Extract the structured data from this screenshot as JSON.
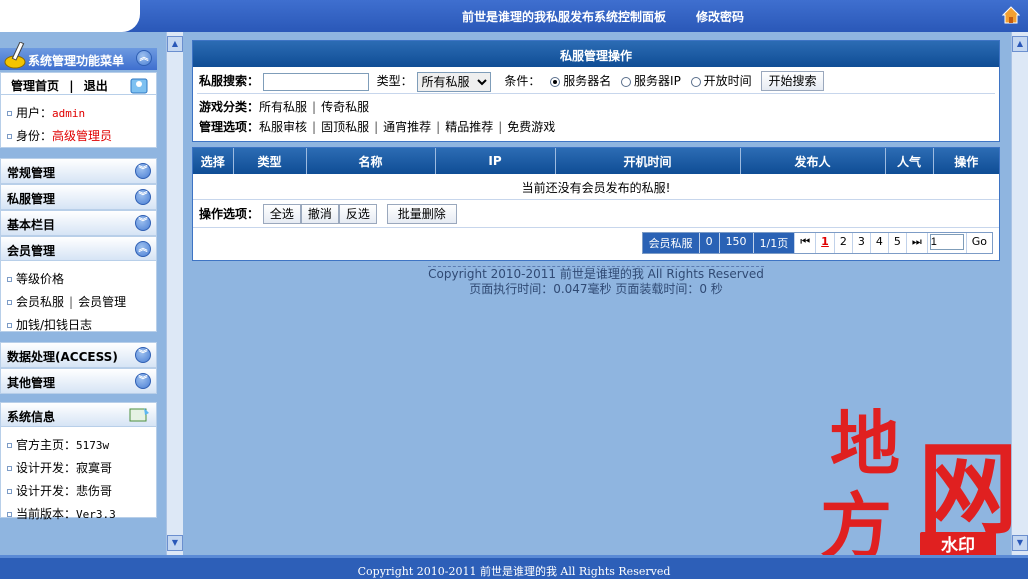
{
  "header": {
    "title": "前世是谁理的我私服发布系统控制面板",
    "change_password": "修改密码",
    "home_icon": "home-icon"
  },
  "sidebar": {
    "menu_title": "系统管理功能菜单",
    "top_links": {
      "home": "管理首页",
      "sep": "|",
      "logout": "退出"
    },
    "user": {
      "user_label": "用户：",
      "user_value": "admin",
      "role_label": "身份：",
      "role_value": "高级管理员"
    },
    "sections": [
      {
        "label": "常规管理",
        "state": "collapsed"
      },
      {
        "label": "私服管理",
        "state": "collapsed"
      },
      {
        "label": "基本栏目",
        "state": "collapsed"
      },
      {
        "label": "会员管理",
        "state": "expanded",
        "items": [
          "等级价格",
          "会员私服",
          "会员管理",
          "加钱/扣钱日志"
        ]
      },
      {
        "label": "数据处理(ACCESS)",
        "state": "collapsed"
      },
      {
        "label": "其他管理",
        "state": "collapsed"
      }
    ],
    "sysinfo": {
      "title": "系统信息",
      "items": [
        "官方主页：",
        "5173w",
        "设计开发：寂寞哥",
        "设计开发：悲伤哥",
        "当前版本：",
        "Ver3.3"
      ]
    }
  },
  "main": {
    "panel_title": "私服管理操作",
    "search": {
      "label": "私服搜索：",
      "input_value": "",
      "type_label": "类型：",
      "type_selected": "所有私服",
      "cond_label": "条件：",
      "options": [
        "服务器名",
        "服务器IP",
        "开放时间"
      ],
      "selected_option": "服务器名",
      "button": "开始搜索"
    },
    "game_category": {
      "label": "游戏分类：",
      "links": [
        "所有私服",
        "传奇私服"
      ]
    },
    "manage_options": {
      "label": "管理选项：",
      "links": [
        "私服审核",
        "固顶私服",
        "通宵推荐",
        "精品推荐",
        "免费游戏"
      ]
    },
    "table": {
      "columns": [
        "选择",
        "类型",
        "名称",
        "IP",
        "开机时间",
        "发布人",
        "人气",
        "操作"
      ],
      "empty_message": "当前还没有会员发布的私服!"
    },
    "ops": {
      "label": "操作选项：",
      "select_all": "全选",
      "cancel": "撤消",
      "invert": "反选",
      "batch_delete": "批量删除"
    },
    "pager": {
      "label": "会员私服",
      "count": "0",
      "per_page": "150",
      "page_info": "1/1页",
      "first": "⏮",
      "pages": [
        "1",
        "2",
        "3",
        "4",
        "5"
      ],
      "current_page": "1",
      "last": "⏭",
      "go_value": "1",
      "go": "Go"
    },
    "footer": {
      "copyright": "Copyright 2010-2011 前世是谁理的我  All Rights Reserved",
      "timing": "页面执行时间：0.047毫秒   页面装载时间：0 秒"
    }
  },
  "bottom": {
    "copyright": "Copyright 2010-2011 前世是谁理的我 All Rights Reserved"
  },
  "watermark": {
    "chars": [
      "地",
      "方",
      "网"
    ],
    "badge": "水印"
  },
  "colors": {
    "header_blue": "#2a58b8",
    "table_head": "#0f4d95",
    "red": "#e00000",
    "watermark_red": "#e02020"
  }
}
